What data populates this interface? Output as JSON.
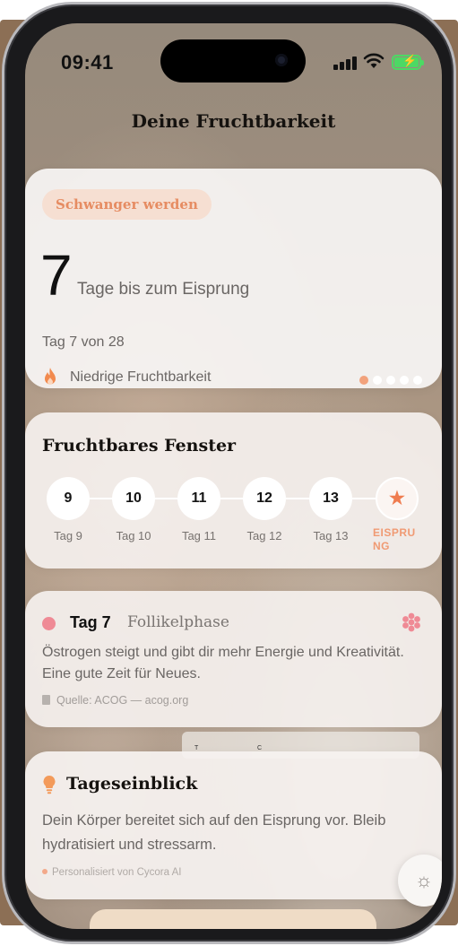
{
  "status_bar": {
    "time": "09:41"
  },
  "header": {
    "title": "Deine Fruchtbarkeit"
  },
  "cycle_card": {
    "goal_badge": "Schwanger werden",
    "days_until": "7",
    "days_label": "Tage bis zum Eisprung",
    "cycle_progress": "Tag 7 von 28",
    "fertility_level": "Niedrige Fruchtbarkeit",
    "page_dots": {
      "total": 5,
      "active": 1
    }
  },
  "window_card": {
    "title": "Fruchtbares Fenster",
    "days": [
      {
        "number": "9",
        "label": "Tag 9"
      },
      {
        "number": "10",
        "label": "Tag 10"
      },
      {
        "number": "11",
        "label": "Tag 11"
      },
      {
        "number": "12",
        "label": "Tag 12"
      },
      {
        "number": "13",
        "label": "Tag 13"
      }
    ],
    "ovulation": {
      "icon": "star-icon",
      "label": "EISPRUNG"
    }
  },
  "phase_card": {
    "day": "Tag 7",
    "phase": "Follikelphase",
    "description": "Östrogen steigt und gibt dir mehr Energie und Kreativität. Eine gute Zeit für Neues.",
    "source": "Quelle: ACOG — acog.org",
    "accent_color": "#ef8a95"
  },
  "background": {
    "tag_left": "T",
    "tag_right": "C"
  },
  "insight_card": {
    "title": "Tageseinblick",
    "text": "Dein Körper bereitet sich auf den Eisprung vor. Bleib hydratisiert und stressarm.",
    "attribution": "Personalisiert von Cycora AI"
  },
  "fab": {
    "icon": "sun-icon"
  },
  "colors": {
    "accent": "#f09a73",
    "badge_bg": "#f6dfd2",
    "battery": "#4cd964"
  }
}
